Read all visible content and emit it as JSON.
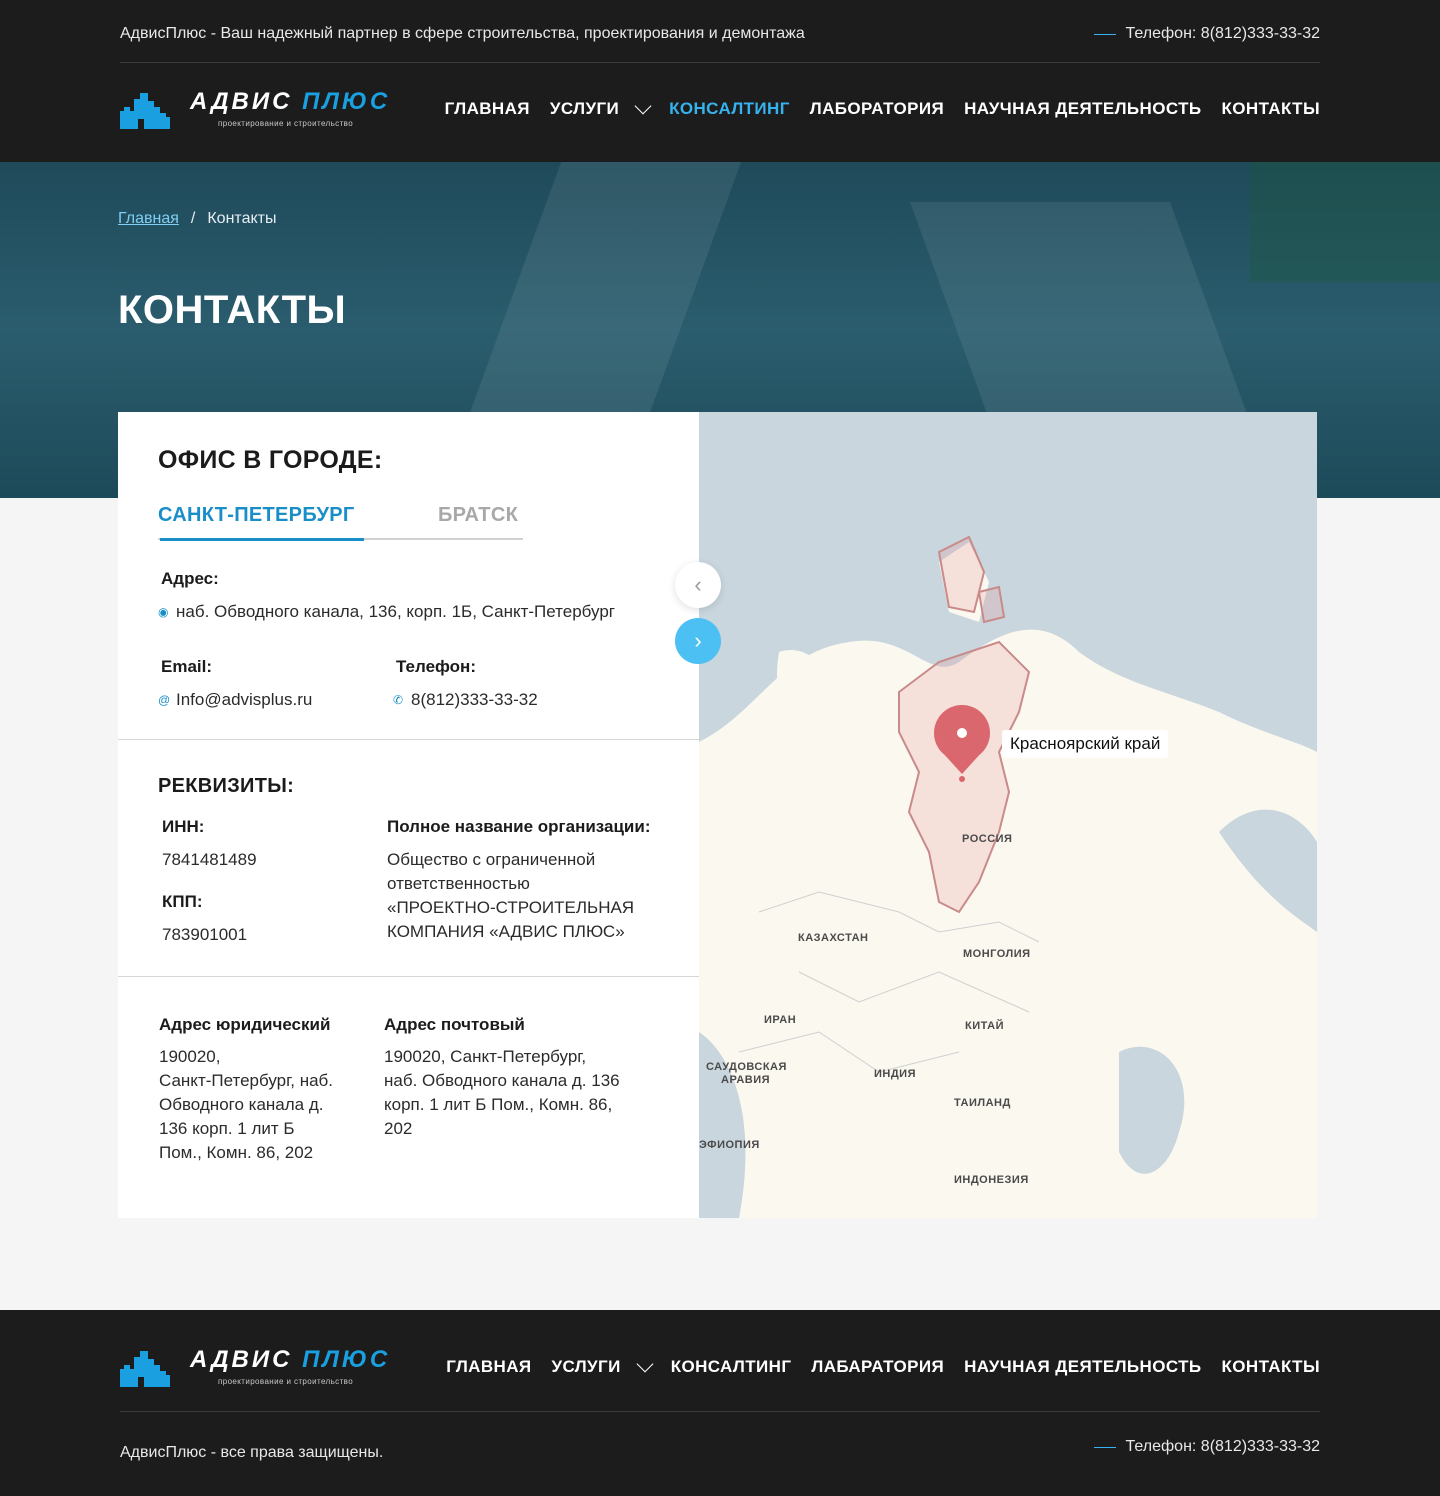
{
  "header": {
    "tagline": "АдвисПлюс - Ваш надежный партнер в сфере строительства, проектирования и демонтажа",
    "phone": "Телефон: 8(812)333-33-32",
    "logo_name_main": "АДВИС ",
    "logo_name_accent": "ПЛЮС",
    "logo_sub": "проектирование и строительство",
    "menu": [
      {
        "label": "ГЛАВНАЯ"
      },
      {
        "label": "УСЛУГИ"
      },
      {
        "label": "КОНСАЛТИНГ"
      },
      {
        "label": "ЛАБОРАТОРИЯ"
      },
      {
        "label": "НАУЧНАЯ ДЕЯТЕЛЬНОСТЬ"
      },
      {
        "label": "КОНТАКТЫ"
      }
    ]
  },
  "hero": {
    "breadcrumb_home": "Главная",
    "breadcrumb_sep": "/",
    "breadcrumb_current": "Контакты",
    "title": "КОНТАКТЫ"
  },
  "office": {
    "title": "ОФИС В ГОРОДЕ:",
    "tabs": [
      "САНКТ-ПЕТЕРБУРГ",
      "БРАТСК"
    ],
    "address_label": "Адрес:",
    "address": "наб. Обводного канала, 136, корп. 1Б, Санкт-Петербург",
    "email_label": "Email:",
    "email": "Info@advisplus.ru",
    "phone_label": "Телефон:",
    "phone": "8(812)333-33-32"
  },
  "requisites": {
    "title": "РЕКВИЗИТЫ:",
    "inn_label": "ИНН:",
    "inn": "7841481489",
    "kpp_label": "КПП:",
    "kpp": "783901001",
    "org_label": "Полное название организации:",
    "org": "Общество с ограниченной\nответственностью\n«ПРОЕКТНО-СТРОИТЕЛЬНАЯ\nКОМПАНИЯ «АДВИС ПЛЮС»",
    "legal_label": "Адрес юридический",
    "legal": "190020,\nСанкт-Петербург, наб.\nОбводного канала д.\n136 корп. 1 лит Б\nПом., Комн. 86, 202",
    "postal_label": "Адрес почтовый",
    "postal": "190020, Санкт-Петербург,\nнаб. Обводного канала д. 136\nкорп. 1 лит Б Пом., Комн. 86,\n202"
  },
  "map": {
    "pin_label": "Красноярский край",
    "labels": [
      "РОССИЯ",
      "КАЗАХСТАН",
      "МОНГОЛИЯ",
      "КИТАЙ",
      "ИРАН",
      "САУДОВСКАЯ",
      "АРАВИЯ",
      "ИНДИЯ",
      "ТАИЛАНД",
      "ИНДОНЕЗИЯ",
      "ЭФИОПИЯ"
    ]
  },
  "footer": {
    "menu": [
      "ГЛАВНАЯ",
      "УСЛУГИ",
      "КОНСАЛТИНГ",
      "ЛАБАРАТОРИЯ",
      "НАУЧНАЯ ДЕЯТЕЛЬНОСТЬ",
      "КОНТАКТЫ"
    ],
    "rights": "АдвисПлюс - все права защищены.",
    "phone": "Телефон: 8(812)333-33-32"
  },
  "colors": {
    "accent": "#1a8ec8",
    "accent_light": "#36b3ee",
    "dark": "#1c1c1c"
  }
}
